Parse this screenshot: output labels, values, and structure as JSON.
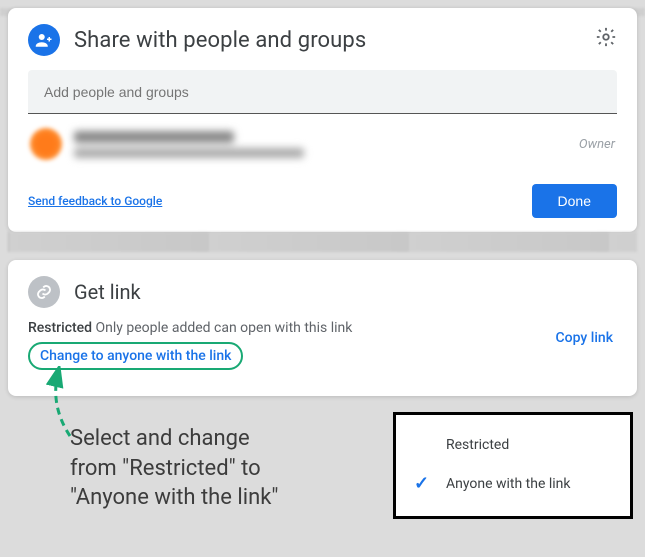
{
  "share": {
    "title": "Share with people and groups",
    "input_placeholder": "Add people and groups",
    "owner_label": "Owner",
    "feedback": "Send feedback to Google",
    "done": "Done"
  },
  "link": {
    "title": "Get link",
    "status_bold": "Restricted",
    "status_desc": " Only people added can open with this link",
    "change": "Change to anyone with the link",
    "copy": "Copy link"
  },
  "dropdown": {
    "option_restricted": "Restricted",
    "option_anyone": "Anyone with the link"
  },
  "annotation": {
    "line1": "Select and change",
    "line2": "from \"Restricted\" to",
    "line3": "\"Anyone with the link\""
  },
  "colors": {
    "accent": "#1a73e8",
    "highlight": "#19a974"
  }
}
